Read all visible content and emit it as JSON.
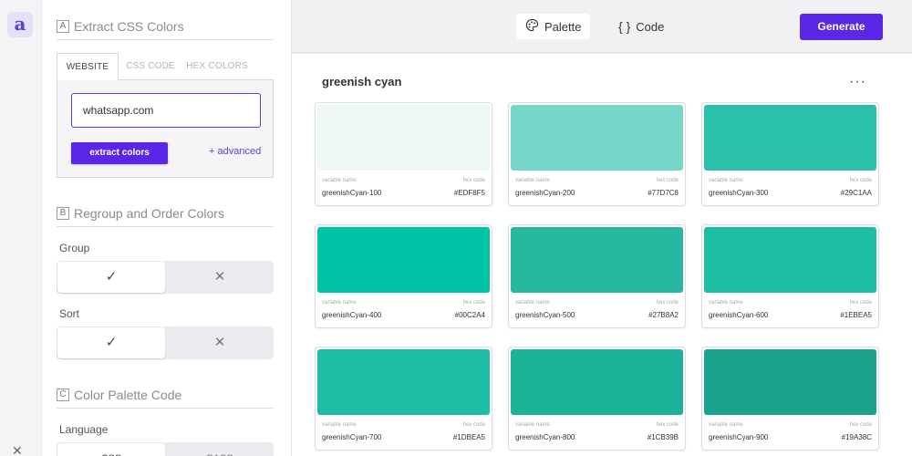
{
  "app": {
    "logo": "a"
  },
  "section_a": {
    "letter": "A",
    "title": "Extract CSS Colors"
  },
  "tabs": [
    "WEBSITE",
    "CSS CODE",
    "HEX COLORS"
  ],
  "url_input": {
    "value": "whatsapp.com"
  },
  "extract_button": "extract colors",
  "advanced_link": "+ advanced",
  "section_b": {
    "letter": "B",
    "title": "Regroup and Order Colors"
  },
  "group_label": "Group",
  "sort_label": "Sort",
  "section_c": {
    "letter": "C",
    "title": "Color Palette Code"
  },
  "language_label": "Language",
  "language_options": [
    "CSS",
    "SASS"
  ],
  "toggle_glyphs": {
    "on": "✓",
    "off": "✕"
  },
  "topbar": {
    "palette_tab": "Palette",
    "code_tab": "Code",
    "palette_icon": "palette-icon",
    "code_icon": "braces-icon",
    "generate": "Generate"
  },
  "palette": {
    "title": "greenish cyan",
    "more": "···",
    "variable_label": "variable name",
    "hex_label": "hex code",
    "colors": [
      {
        "name": "greenishCyan-100",
        "hex": "#EDF8F5"
      },
      {
        "name": "greenishCyan-200",
        "hex": "#77D7C8"
      },
      {
        "name": "greenishCyan-300",
        "hex": "#29C1AA"
      },
      {
        "name": "greenishCyan-400",
        "hex": "#00C2A4"
      },
      {
        "name": "greenishCyan-500",
        "hex": "#27B8A2"
      },
      {
        "name": "greenishCyan-600",
        "hex": "#1EBEA5"
      },
      {
        "name": "greenishCyan-700",
        "hex": "#1DBEA5"
      },
      {
        "name": "greenishCyan-800",
        "hex": "#1CB39B"
      },
      {
        "name": "greenishCyan-900",
        "hex": "#19A38C"
      }
    ]
  },
  "colors": {
    "accent": "#5A27E6"
  }
}
